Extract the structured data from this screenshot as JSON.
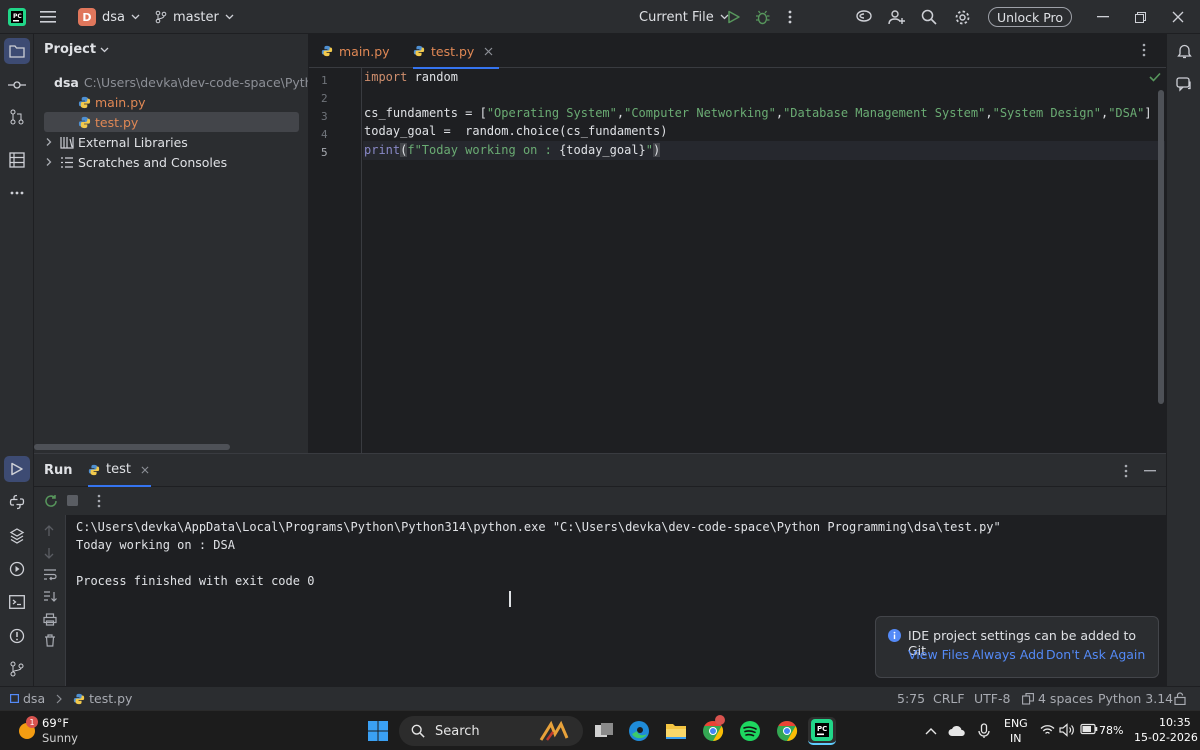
{
  "titlebar": {
    "project_initial": "D",
    "project_name": "dsa",
    "branch": "master",
    "run_config": "Current File",
    "unlock_label": "Unlock Pro"
  },
  "project_panel": {
    "title": "Project",
    "root_name": "dsa",
    "root_path": "C:\\Users\\devka\\dev-code-space\\Python",
    "files": [
      "main.py",
      "test.py"
    ],
    "external_libraries": "External Libraries",
    "scratches": "Scratches and Consoles"
  },
  "editor": {
    "tabs": [
      {
        "label": "main.py"
      },
      {
        "label": "test.py"
      }
    ],
    "line_numbers": [
      "1",
      "2",
      "3",
      "4",
      "5"
    ],
    "code": {
      "l1_kw": "import",
      "l1_rest": " random",
      "l3_a": "cs_fundaments = [",
      "l3_s1": "\"Operating System\"",
      "l3_s2": "\"Computer Networking\"",
      "l3_s3": "\"Database Management System\"",
      "l3_s4": "\"System Design\"",
      "l3_s5": "\"DSA\"",
      "comma": ",",
      "l3_end": "]",
      "l4": "today_goal =  random.choice(cs_fundaments)",
      "l5_print": "print",
      "l5_open": "(",
      "l5_f": "f\"Today working on : ",
      "l5_expr": "{today_goal}",
      "l5_q": "\"",
      "l5_close": ")"
    }
  },
  "run_panel": {
    "title": "Run",
    "tab_label": "test",
    "output": [
      "C:\\Users\\devka\\AppData\\Local\\Programs\\Python\\Python314\\python.exe \"C:\\Users\\devka\\dev-code-space\\Python Programming\\dsa\\test.py\"",
      "Today working on : DSA",
      "",
      "Process finished with exit code 0"
    ]
  },
  "notification": {
    "message": "IDE project settings can be added to Git",
    "actions": [
      "View Files",
      "Always Add",
      "Don't Ask Again"
    ]
  },
  "statusbar": {
    "crumb_project": "dsa",
    "crumb_file": "test.py",
    "position": "5:75",
    "line_sep": "CRLF",
    "encoding": "UTF-8",
    "indent": "4 spaces",
    "interpreter": "Python 3.14"
  },
  "taskbar": {
    "weather_temp": "69°F",
    "weather_desc": "Sunny",
    "weather_badge": "1",
    "search_label": "Search",
    "lang_top": "ENG",
    "lang_bottom": "IN",
    "battery": "78%",
    "time": "10:35",
    "date": "15-02-2026"
  },
  "colors": {
    "accent": "#3574f0",
    "keyword": "#cf8e6d",
    "string": "#6aab73",
    "link": "#548af7"
  }
}
